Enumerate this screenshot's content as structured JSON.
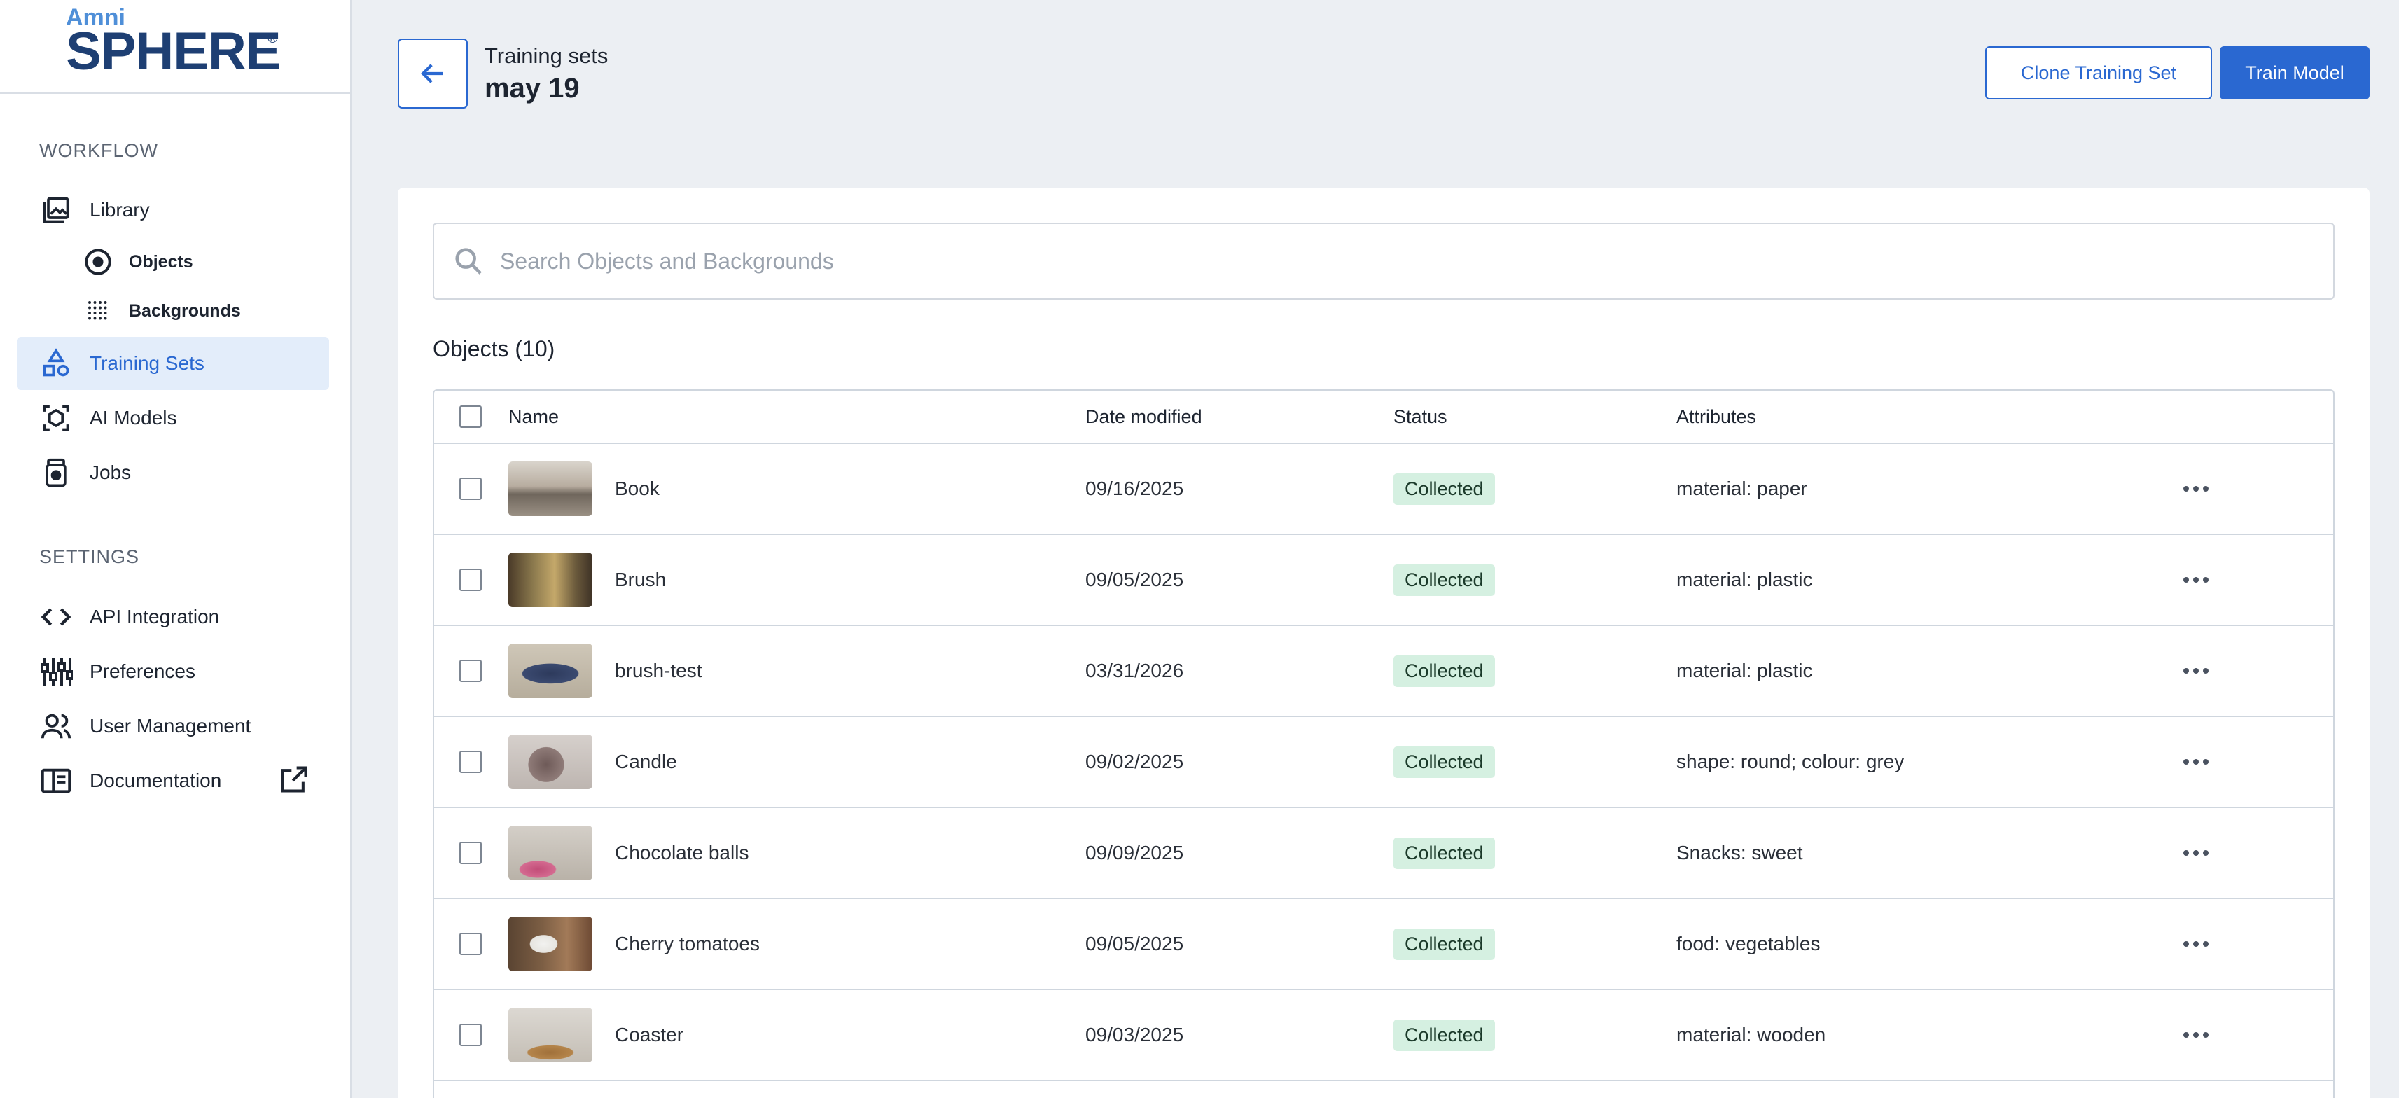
{
  "brand": {
    "small": "Amni",
    "big": "SPHERE",
    "reg": "®"
  },
  "sidebar": {
    "workflow_label": "WORKFLOW",
    "settings_label": "SETTINGS",
    "workflow_items": [
      {
        "label": "Library",
        "icon": "library-icon"
      },
      {
        "label": "Objects",
        "icon": "objects-icon"
      },
      {
        "label": "Backgrounds",
        "icon": "backgrounds-icon"
      },
      {
        "label": "Training Sets",
        "icon": "training-sets-icon",
        "active": true
      },
      {
        "label": "AI Models",
        "icon": "ai-models-icon"
      },
      {
        "label": "Jobs",
        "icon": "jobs-icon"
      }
    ],
    "settings_items": [
      {
        "label": "API Integration",
        "icon": "code-icon"
      },
      {
        "label": "Preferences",
        "icon": "sliders-icon"
      },
      {
        "label": "User Management",
        "icon": "users-icon"
      },
      {
        "label": "Documentation",
        "icon": "book-icon"
      }
    ]
  },
  "header": {
    "breadcrumb": "Training sets",
    "title": "may 19",
    "clone_label": "Clone Training Set",
    "train_label": "Train Model"
  },
  "search": {
    "placeholder": "Search Objects and Backgrounds",
    "value": ""
  },
  "objects": {
    "heading": "Objects (10)",
    "columns": {
      "name": "Name",
      "date": "Date modified",
      "status": "Status",
      "attributes": "Attributes"
    },
    "rows": [
      {
        "name": "Book",
        "date": "09/16/2025",
        "status": "Collected",
        "attributes": "material: paper"
      },
      {
        "name": "Brush",
        "date": "09/05/2025",
        "status": "Collected",
        "attributes": "material: plastic"
      },
      {
        "name": "brush-test",
        "date": "03/31/2026",
        "status": "Collected",
        "attributes": "material: plastic"
      },
      {
        "name": "Candle",
        "date": "09/02/2025",
        "status": "Collected",
        "attributes": "shape: round; colour: grey"
      },
      {
        "name": "Chocolate balls",
        "date": "09/09/2025",
        "status": "Collected",
        "attributes": "Snacks: sweet"
      },
      {
        "name": "Cherry tomatoes",
        "date": "09/05/2025",
        "status": "Collected",
        "attributes": "food: vegetables"
      },
      {
        "name": "Coaster",
        "date": "09/03/2025",
        "status": "Collected",
        "attributes": "material: wooden"
      }
    ]
  },
  "colors": {
    "accent": "#2a68d1",
    "active_bg": "#e3edfa",
    "badge_bg": "#d5f0e1",
    "page_bg": "#eceff3"
  }
}
